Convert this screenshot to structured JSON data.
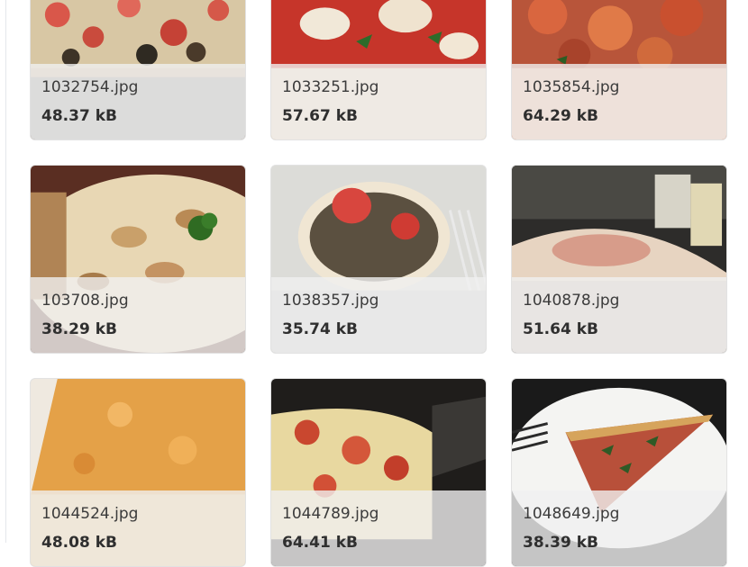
{
  "gallery": {
    "items": [
      {
        "filename": "1032754.jpg",
        "size": "48.37 kB",
        "image": "pizza-photo-tomato-eggplant"
      },
      {
        "filename": "1033251.jpg",
        "size": "57.67 kB",
        "image": "pizza-photo-margherita"
      },
      {
        "filename": "1035854.jpg",
        "size": "64.29 kB",
        "image": "pizza-photo-red-sauce"
      },
      {
        "filename": "103708.jpg",
        "size": "38.29 kB",
        "image": "pizza-photo-white-pie-parsley"
      },
      {
        "filename": "1038357.jpg",
        "size": "35.74 kB",
        "image": "pizza-photo-strawberry-plate"
      },
      {
        "filename": "1040878.jpg",
        "size": "51.64 kB",
        "image": "pizza-photo-slice-night"
      },
      {
        "filename": "1044524.jpg",
        "size": "48.08 kB",
        "image": "pizza-photo-cheese-slice"
      },
      {
        "filename": "1044789.jpg",
        "size": "64.41 kB",
        "image": "pizza-photo-pepperoni-pan"
      },
      {
        "filename": "1048649.jpg",
        "size": "38.39 kB",
        "image": "pizza-photo-slice-basil"
      }
    ]
  }
}
